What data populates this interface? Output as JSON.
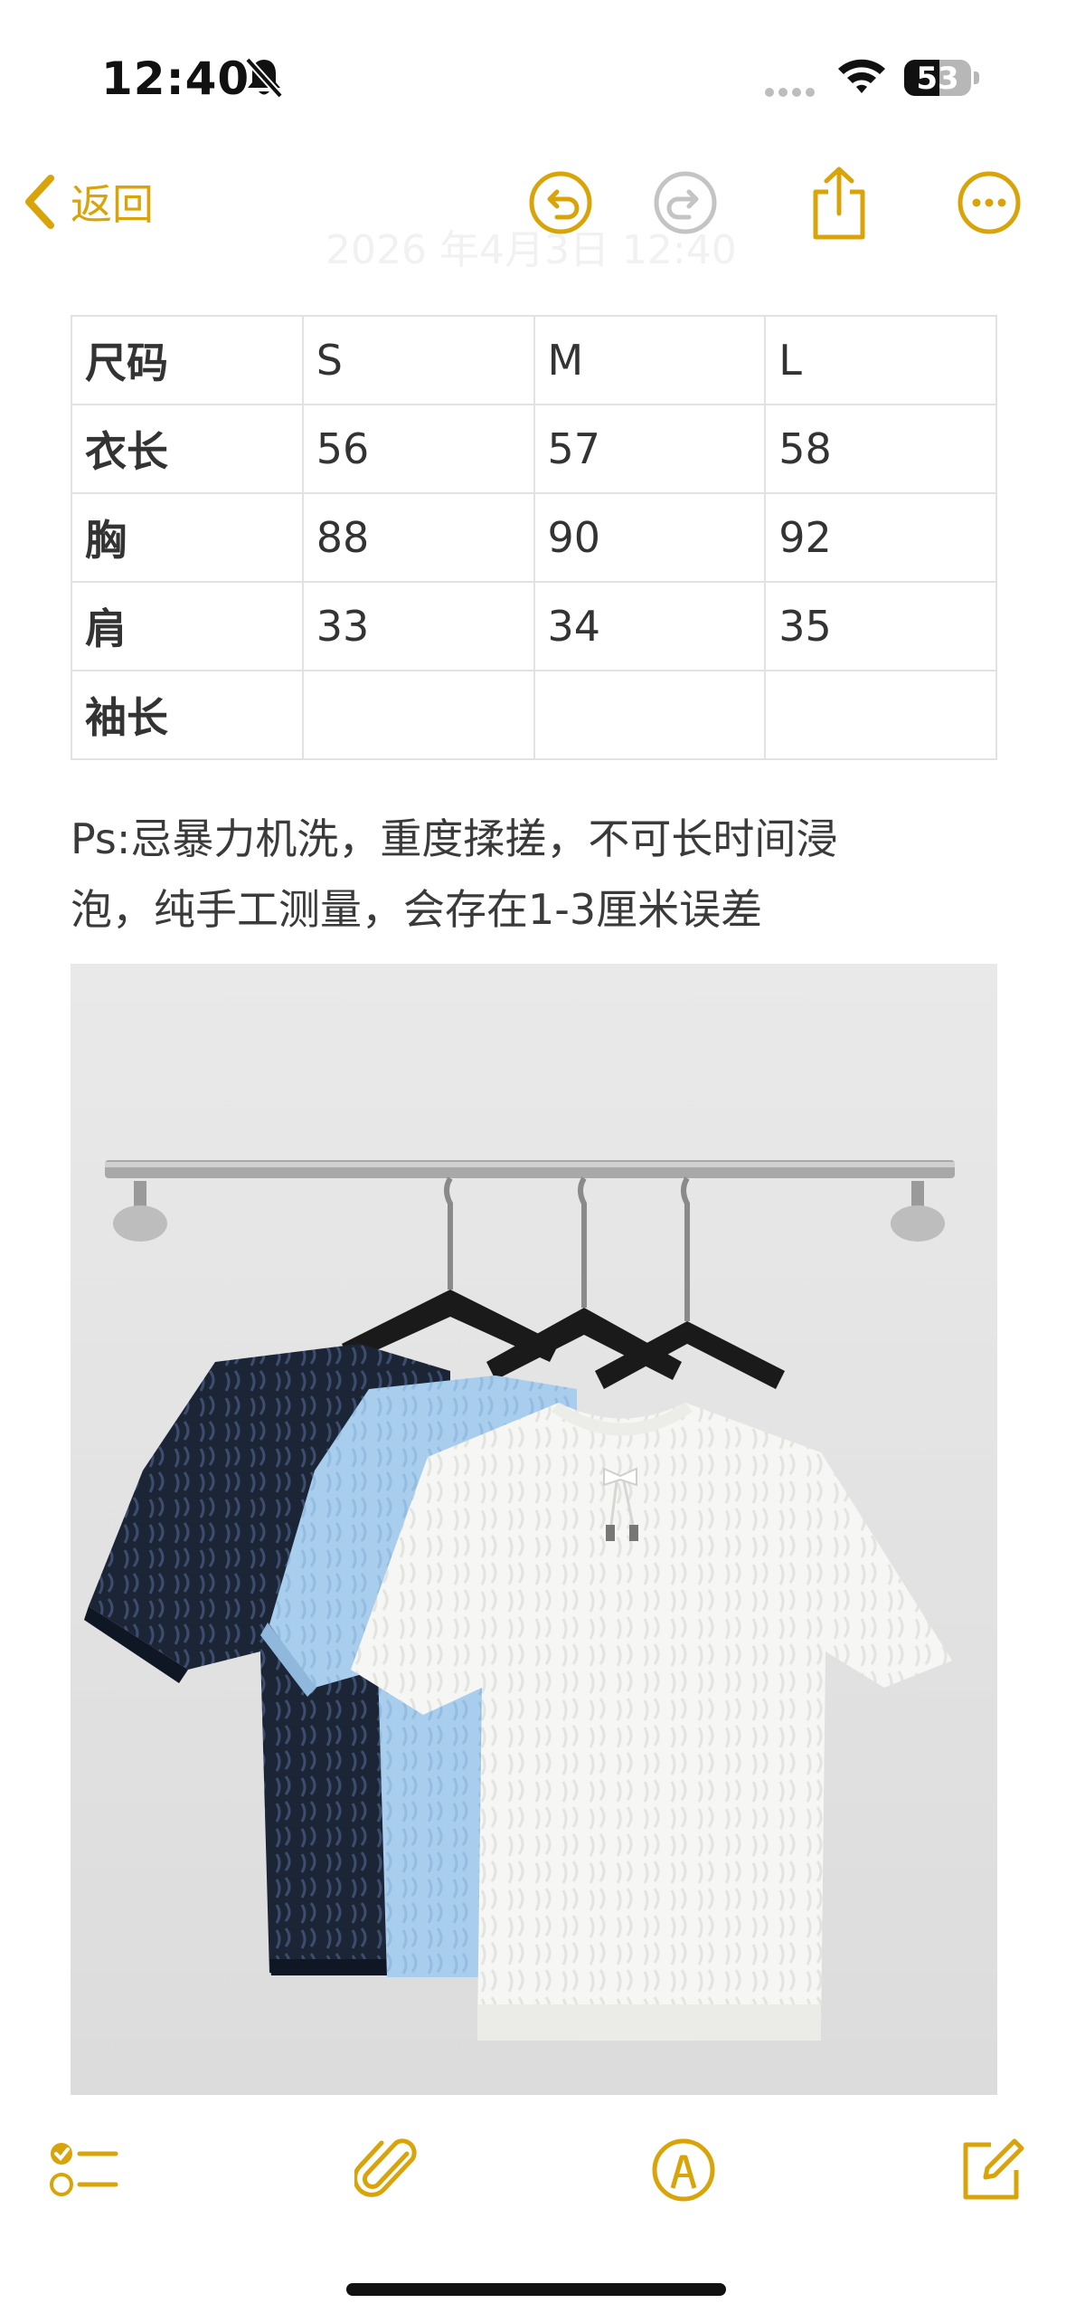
{
  "status_bar": {
    "time": "12:40",
    "battery_level": "53",
    "battery_fraction": 0.53
  },
  "nav": {
    "back_label": "返回",
    "faded_date": "2026 年4月3日 12:40"
  },
  "colors": {
    "accent": "#d9a40a",
    "disabled": "#c4c4c4"
  },
  "icons": {
    "back": "chevron-left-icon",
    "undo": "undo-icon",
    "redo": "redo-icon",
    "share": "share-icon",
    "more": "more-icon",
    "checklist": "checklist-icon",
    "attach": "paperclip-icon",
    "markup": "markup-pen-icon",
    "compose": "compose-icon"
  },
  "size_table": {
    "rows": [
      [
        "尺码",
        "S",
        "M",
        "L"
      ],
      [
        "衣长",
        "56",
        "57",
        "58"
      ],
      [
        "胸",
        "88",
        "90",
        "92"
      ],
      [
        "肩",
        "33",
        "34",
        "35"
      ],
      [
        "袖长",
        "",
        "",
        ""
      ]
    ]
  },
  "note": {
    "line1": "Ps:忌暴力机洗，重度揉搓，不可长时间浸",
    "line2": "泡，纯手工测量，会存在1-3厘米误差"
  }
}
